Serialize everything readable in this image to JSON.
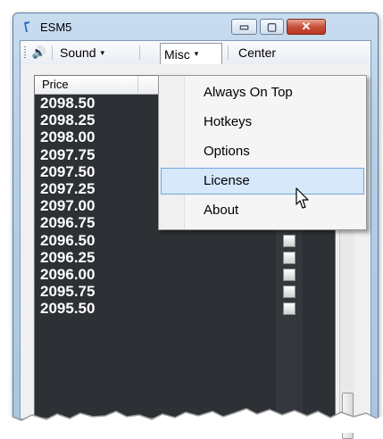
{
  "window": {
    "title": "ESM5",
    "minimize_glyph": "▭",
    "maximize_glyph": "▢",
    "close_glyph": "✕"
  },
  "toolbar": {
    "speaker_icon": "🔊",
    "sound_label": "Sound",
    "misc_label": "Misc",
    "center_label": "Center",
    "caret": "▾"
  },
  "grid": {
    "columns": {
      "price": "Price"
    },
    "prices": [
      "2098.50",
      "2098.25",
      "2098.00",
      "2097.75",
      "2097.50",
      "2097.25",
      "2097.00",
      "2096.75",
      "2096.50",
      "2096.25",
      "2096.00",
      "2095.75",
      "2095.50"
    ]
  },
  "menu": {
    "items": [
      {
        "label": "Always On Top",
        "highlighted": false
      },
      {
        "label": "Hotkeys",
        "highlighted": false
      },
      {
        "label": "Options",
        "highlighted": false
      },
      {
        "label": "License",
        "highlighted": true
      },
      {
        "label": "About",
        "highlighted": false
      }
    ]
  },
  "colors": {
    "grid_bg": "#2d3034",
    "highlight": "#d6e8fa",
    "close_red": "#c8503a"
  }
}
